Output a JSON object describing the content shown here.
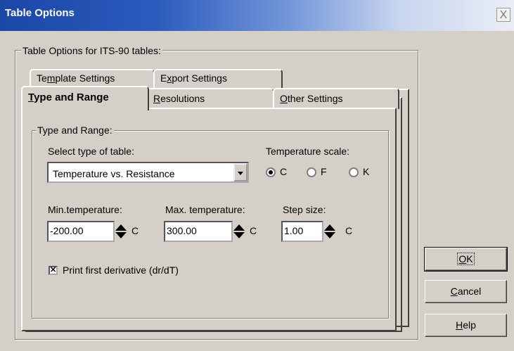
{
  "window": {
    "title": "Table Options",
    "close_glyph": "X"
  },
  "group": {
    "label": "Table Options for ITS-90 tables:"
  },
  "tabs": {
    "template": {
      "pre": "Te",
      "key": "m",
      "post": "plate Settings"
    },
    "export": {
      "pre": "E",
      "key": "x",
      "post": "port Settings"
    },
    "type": {
      "pre": "",
      "key": "T",
      "post": "ype and Range"
    },
    "resolutions": {
      "pre": "",
      "key": "R",
      "post": "esolutions"
    },
    "other": {
      "pre": "",
      "key": "O",
      "post": "ther Settings"
    }
  },
  "panel": {
    "group_label": "Type and Range:",
    "select_label": "Select type of table:",
    "select_value": "Temperature vs. Resistance",
    "scale_label": "Temperature scale:",
    "scale_options": [
      "C",
      "F",
      "K"
    ],
    "scale_selected": "C",
    "min_label": "Min.temperature:",
    "min_value": "-200.00",
    "max_label": "Max. temperature:",
    "max_value": "300.00",
    "step_label": "Step size:",
    "step_value": "1.00",
    "unit": "C",
    "derivative_label": "Print first derivative (dr/dT)",
    "derivative_checked": true,
    "check_glyph": "✕"
  },
  "buttons": {
    "ok": {
      "pre": "",
      "key": "O",
      "post": "K"
    },
    "cancel": {
      "pre": "",
      "key": "C",
      "post": "ancel"
    },
    "help": {
      "pre": "",
      "key": "H",
      "post": "elp"
    }
  }
}
